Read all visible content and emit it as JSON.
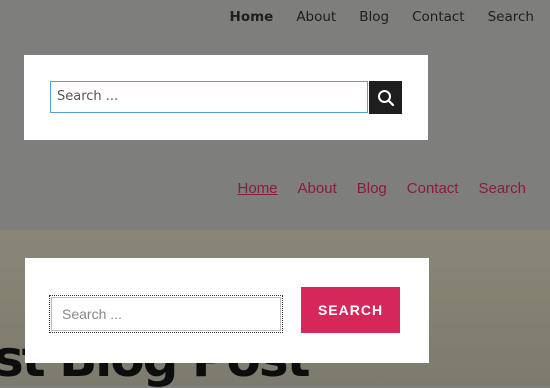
{
  "theme1": {
    "nav": {
      "home": "Home",
      "about": "About",
      "blog": "Blog",
      "contact": "Contact",
      "search": "Search"
    },
    "search": {
      "placeholder": "Search ...",
      "button_icon": "search-icon"
    }
  },
  "theme2": {
    "nav": {
      "home": "Home",
      "about": "About",
      "blog": "Blog",
      "contact": "Contact",
      "search": "Search"
    },
    "search": {
      "placeholder": "Search ...",
      "button_label": "SEARCH"
    },
    "background_title": "st Blog Post"
  },
  "colors": {
    "accent": "#d5275a",
    "nav_link": "#8b1c3b",
    "dark_button": "#1e1e1e"
  }
}
